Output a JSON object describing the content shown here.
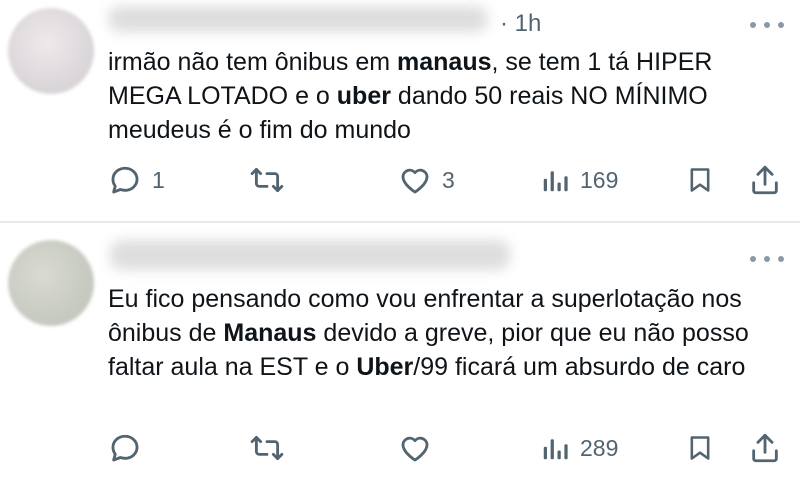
{
  "tweets": [
    {
      "time": "· 1h",
      "text": {
        "p1": "irmão não tem ônibus em ",
        "b1": "manaus",
        "p2": ", se tem 1 tá HIPER MEGA LOTADO e o ",
        "b2": "uber",
        "p3": " dando 50 reais NO MÍNIMO meudeus é o fim do mundo"
      },
      "actions": {
        "replies": "1",
        "reposts": "",
        "likes": "3",
        "views": "169"
      }
    },
    {
      "time": "",
      "text": {
        "p1": "Eu fico pensando como vou enfrentar a superlotação nos ônibus de ",
        "b1": "Manaus",
        "p2": " devido a greve, pior que eu não posso faltar aula na EST e o ",
        "b2": "Uber",
        "p3": "/99 ficará um absurdo de caro"
      },
      "actions": {
        "replies": "",
        "reposts": "",
        "likes": "",
        "views": "289"
      }
    }
  ],
  "icons": [
    "reply-icon",
    "repost-icon",
    "like-icon",
    "views-icon",
    "bookmark-icon",
    "share-icon",
    "more-icon"
  ],
  "colors": {
    "icon": "#536471",
    "text": "#0f1419",
    "divider": "#e7e9ea"
  }
}
